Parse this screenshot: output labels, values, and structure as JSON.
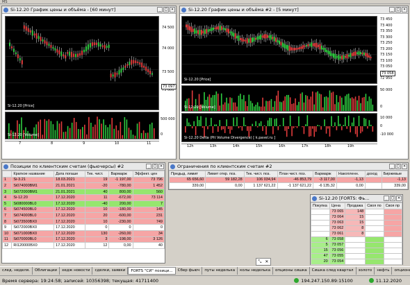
{
  "top": {
    "menu_label": "MS"
  },
  "chart1": {
    "title": "Si-12.20 График цены и объёма - [60 минут]",
    "price_label": "Si-12.20 [Price]",
    "volume_label": "Si-12.20 [Volume]",
    "price_ticks": [
      "74 500",
      "74 000",
      "73 500",
      "73 000"
    ],
    "current_price": "73 097",
    "volume_ticks": [
      "500 000",
      "0"
    ],
    "time_ticks": [
      "7",
      "8",
      "9",
      "10",
      "11"
    ]
  },
  "chart2": {
    "title": "Si-12.20 График цены и объёма #2 - [5 минут]",
    "price_label": "Si-12.20 [Price]",
    "volume_label": "Si-12.20 [Volume]",
    "delta_label": "Si-12.20 Delta (Pit Volume Divergence) [ k.pavel.ru ]",
    "price_ticks": [
      "73 450",
      "73 400",
      "73 350",
      "73 300",
      "73 250",
      "73 200",
      "73 150",
      "73 100",
      "73 050",
      "73 000",
      "72 950"
    ],
    "current_price": "73 058",
    "volume_ticks": [
      "50 000",
      "0"
    ],
    "delta_ticks": [
      "10 000",
      "0",
      "-10 000"
    ],
    "time_ticks": [
      "12h",
      "13h",
      "14h",
      "15h",
      "16h",
      "17h",
      "18h",
      "19h"
    ]
  },
  "positions": {
    "title": "Позиции по клиентским счетам (фьючерсы) #2",
    "columns": [
      "",
      "Краткое название",
      "Дата погаше",
      "Тек. чист.",
      "Вармарж",
      "Эффект. цен"
    ],
    "rows": [
      {
        "n": "1",
        "name": "Si-3.21",
        "date": "18.03.2021",
        "net": "19",
        "var": "-1 197,00",
        "price": "73 796",
        "style": "pink"
      },
      {
        "n": "2",
        "name": "Si074000BM1",
        "date": "21.01.2021",
        "net": "-20",
        "var": "-780,00",
        "price": "1 452",
        "style": "pink"
      },
      {
        "n": "3",
        "name": "Si072000BM1",
        "date": "21.01.2021",
        "net": "40",
        "var": "800,00",
        "price": "560",
        "style": "green"
      },
      {
        "n": "4",
        "name": "Si-12.20",
        "date": "17.12.2020",
        "net": "11",
        "var": "-672,00",
        "price": "73 114",
        "style": "pink"
      },
      {
        "n": "5",
        "name": "Si080000BL0",
        "date": "17.12.2020",
        "net": "-40",
        "var": "200,00",
        "price": "7",
        "style": "green"
      },
      {
        "n": "6",
        "name": "Si074500BL0",
        "date": "17.12.2020",
        "net": "10",
        "var": "-180,00",
        "price": "145",
        "style": "pink"
      },
      {
        "n": "7",
        "name": "Si074000BL0",
        "date": "17.12.2020",
        "net": "20",
        "var": "-600,00",
        "price": "231",
        "style": "pink"
      },
      {
        "n": "8",
        "name": "Si073500BX0",
        "date": "17.12.2020",
        "net": "10",
        "var": "-230,00",
        "price": "749",
        "style": "pink"
      },
      {
        "n": "9",
        "name": "Si072000BX0",
        "date": "17.12.2020",
        "net": "0",
        "var": "0",
        "price": "0",
        "style": "white"
      },
      {
        "n": "10",
        "name": "Si071000BX0",
        "date": "17.12.2020",
        "net": "130",
        "var": "-260,00",
        "price": "34",
        "style": "pink"
      },
      {
        "n": "11",
        "name": "Si070000BL0",
        "date": "17.12.2020",
        "net": "3",
        "var": "-198,00",
        "price": "3 126",
        "style": "pink"
      },
      {
        "n": "12",
        "name": "RI120000BX0",
        "date": "17.12.2020",
        "net": "12",
        "var": "0,00",
        "price": "40",
        "style": "white"
      }
    ]
  },
  "limits": {
    "title": "Ограничения по клиентским счетам #2",
    "columns": [
      "Предыд. лимит",
      "Лимит откр. поз.",
      "Тек. чист. поз.",
      "План чист. поз.",
      "Вармарж",
      "Накопленн.",
      "доход",
      "Биржевые"
    ],
    "rows": [
      {
        "a": "65 656,60",
        "b": "59 182,28",
        "c": "106 034,94",
        "d": "-46 853,79",
        "e": "-3 117,00",
        "f": "-1,13",
        "g": "-1,13",
        "style": "pink"
      },
      {
        "a": "339,00",
        "b": "0,00",
        "c": "1 137 621,22",
        "d": "-1 137 621,22",
        "e": "-6 135,32",
        "f": "0,00",
        "g": "339,00",
        "style": "white"
      }
    ]
  },
  "orderbook": {
    "title": "Si-12.20 [FORTS: Фь...",
    "columns": [
      "Покупка",
      "Цена",
      "Продажа",
      "Своя по",
      "Своя пр"
    ],
    "sells": [
      {
        "price": "73 065",
        "qty": "148"
      },
      {
        "price": "73 064",
        "qty": "15"
      },
      {
        "price": "73 063",
        "qty": "15"
      },
      {
        "price": "73 062",
        "qty": "8"
      },
      {
        "price": "73 061",
        "qty": "8"
      }
    ],
    "buys": [
      {
        "qty": "6",
        "price": "73 058"
      },
      {
        "qty": "5",
        "price": "73 057"
      },
      {
        "qty": "15",
        "price": "73 056"
      },
      {
        "qty": "47",
        "price": "73 055"
      },
      {
        "qty": "20",
        "price": "73 054"
      }
    ]
  },
  "mini_window": {
    "icon": "⤡",
    "close": "✕"
  },
  "taskbar": [
    "след. неделя.",
    "Облигации",
    "хедж новости",
    "сделки, заявки",
    "FORTS \"СИ\" позици...",
    "Сбер фьюч",
    "путы неделька",
    "колы неделька",
    "опционы сишка",
    "Сишка след квартал",
    "золото",
    "нефть",
    "опционы ртс",
    "спреды СИ"
  ],
  "status": {
    "server_time": "Время сервера: 19:24:58; записей: 10356398; текущая: 41711400",
    "ip": "194.247.150.89:15100",
    "date": "11.12.2020"
  }
}
